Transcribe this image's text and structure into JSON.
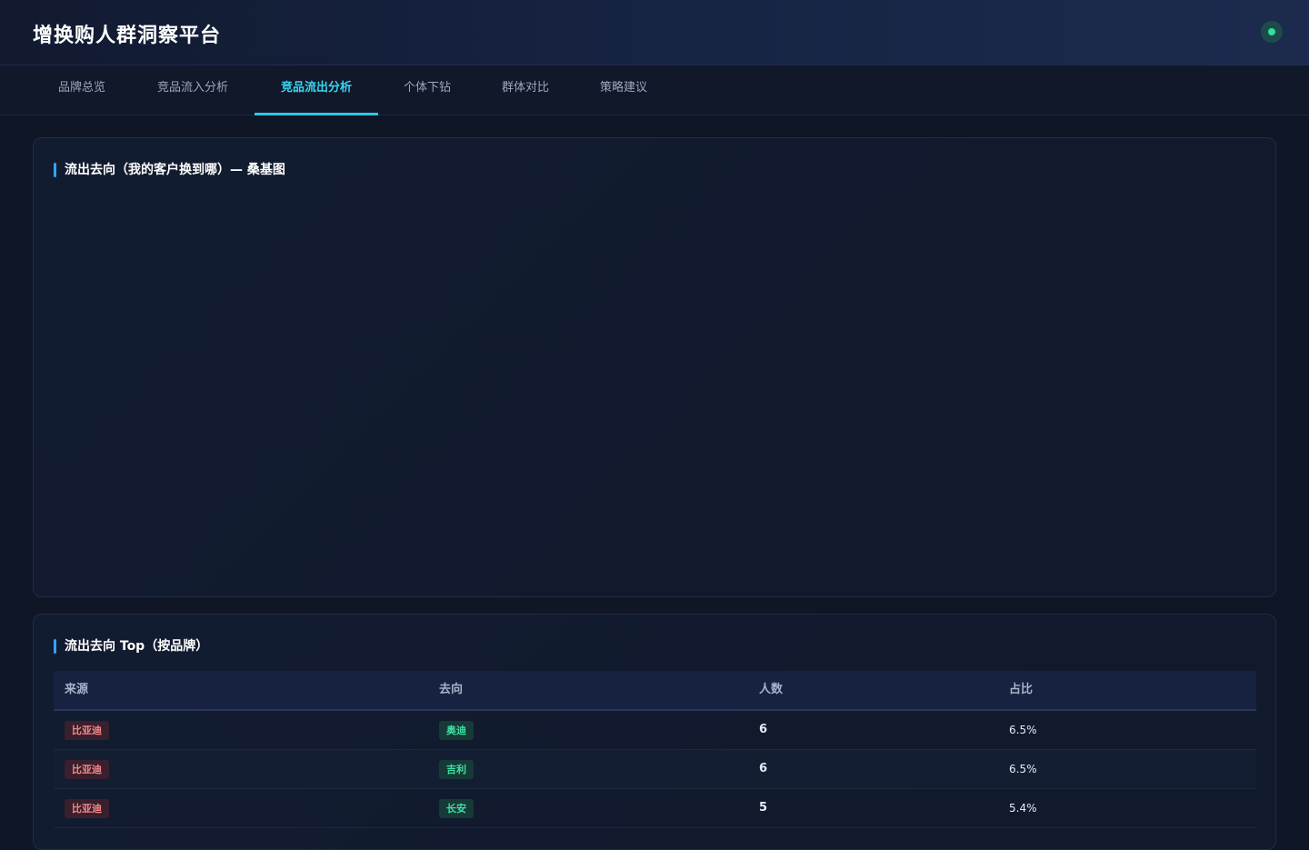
{
  "app": {
    "title": "增换购人群洞察平台",
    "status_color": "#2ee09a"
  },
  "tabs": [
    {
      "label": "品牌总览",
      "active": false
    },
    {
      "label": "竞品流入分析",
      "active": false
    },
    {
      "label": "竞品流出分析",
      "active": true
    },
    {
      "label": "个体下钻",
      "active": false
    },
    {
      "label": "群体对比",
      "active": false
    },
    {
      "label": "策略建议",
      "active": false
    }
  ],
  "sankey_card": {
    "title": "流出去向（我的客户换到哪）— 桑基图"
  },
  "table_card": {
    "title": "流出去向 Top（按品牌）",
    "columns": [
      "来源",
      "去向",
      "人数",
      "占比"
    ],
    "rows": [
      {
        "source": "比亚迪",
        "target": "奥迪",
        "count": "6",
        "ratio": "6.5%"
      },
      {
        "source": "比亚迪",
        "target": "吉利",
        "count": "6",
        "ratio": "6.5%"
      },
      {
        "source": "比亚迪",
        "target": "长安",
        "count": "5",
        "ratio": "5.4%"
      }
    ]
  },
  "colors": {
    "accent": "#38d4f0",
    "title_bar": "#3aa0f5",
    "source_tag": "#f48a8a",
    "target_tag": "#3fe0a5"
  }
}
